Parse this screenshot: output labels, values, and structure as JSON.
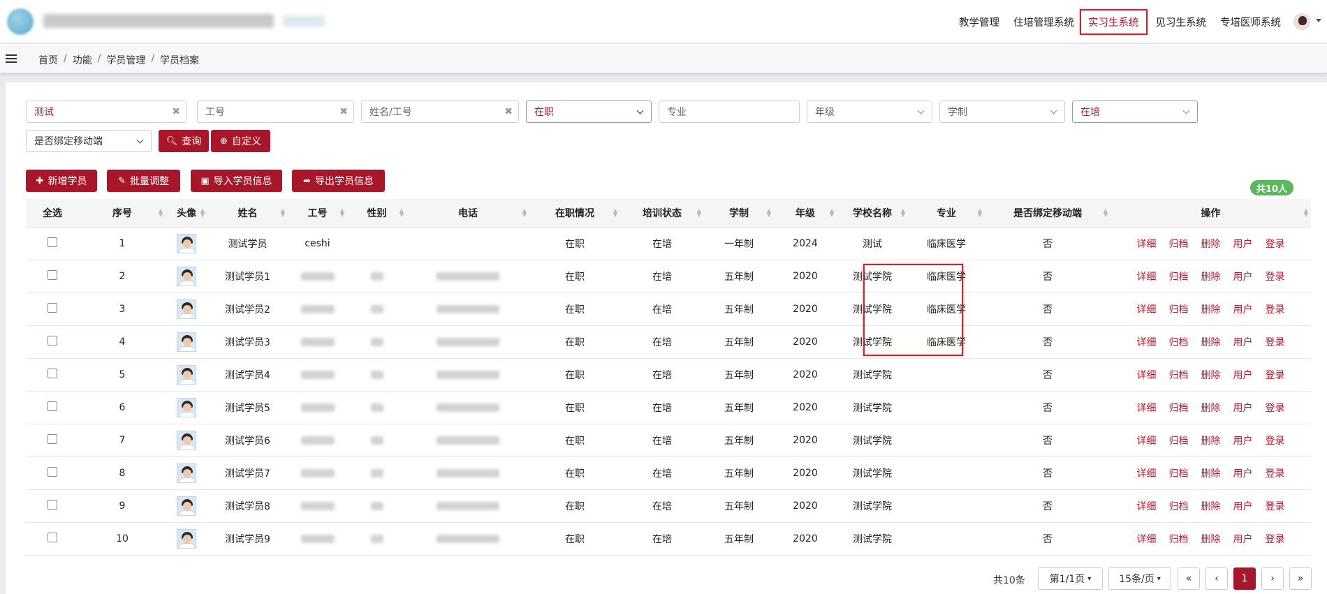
{
  "topnav": {
    "items": [
      "教学管理",
      "住培管理系统",
      "实习生系统",
      "见习生系统",
      "专培医师系统"
    ],
    "active_index": 2
  },
  "breadcrumb": [
    "首页",
    "功能",
    "学员管理",
    "学员档案"
  ],
  "filters": {
    "name_value": "测试",
    "work_id_placeholder": "工号",
    "name_or_id_placeholder": "姓名/工号",
    "job_status_value": "在职",
    "major_placeholder": "专业",
    "grade_placeholder": "年级",
    "schooling_placeholder": "学制",
    "training_status_value": "在培",
    "mobile_bind_placeholder": "是否绑定移动端",
    "query_label": "查询",
    "custom_label": "自定义"
  },
  "actions": {
    "add_label": "新增学员",
    "batch_label": "批量调整",
    "import_label": "导入学员信息",
    "export_label": "导出学员信息"
  },
  "total_badge": "共10人",
  "table": {
    "headers": [
      "全选",
      "序号",
      "头像",
      "姓名",
      "工号",
      "性别",
      "电话",
      "在职情况",
      "培训状态",
      "学制",
      "年级",
      "学校名称",
      "专业",
      "是否绑定移动端",
      "操作"
    ],
    "ops": [
      "详细",
      "归档",
      "删除",
      "用户",
      "登录"
    ],
    "rows": [
      {
        "no": "1",
        "name": "测试学员",
        "work_id": "ceshi",
        "job": "在职",
        "train": "在培",
        "schooling": "一年制",
        "grade": "2024",
        "school": "测试",
        "major": "临床医学",
        "bind": "否"
      },
      {
        "no": "2",
        "name": "测试学员1",
        "work_id": "",
        "job": "在职",
        "train": "在培",
        "schooling": "五年制",
        "grade": "2020",
        "school": "测试学院",
        "major": "临床医学",
        "bind": "否"
      },
      {
        "no": "3",
        "name": "测试学员2",
        "work_id": "",
        "job": "在职",
        "train": "在培",
        "schooling": "五年制",
        "grade": "2020",
        "school": "测试学院",
        "major": "临床医学",
        "bind": "否"
      },
      {
        "no": "4",
        "name": "测试学员3",
        "work_id": "",
        "job": "在职",
        "train": "在培",
        "schooling": "五年制",
        "grade": "2020",
        "school": "测试学院",
        "major": "临床医学",
        "bind": "否"
      },
      {
        "no": "5",
        "name": "测试学员4",
        "work_id": "",
        "job": "在职",
        "train": "在培",
        "schooling": "五年制",
        "grade": "2020",
        "school": "测试学院",
        "major": "",
        "bind": "否"
      },
      {
        "no": "6",
        "name": "测试学员5",
        "work_id": "",
        "job": "在职",
        "train": "在培",
        "schooling": "五年制",
        "grade": "2020",
        "school": "测试学院",
        "major": "",
        "bind": "否"
      },
      {
        "no": "7",
        "name": "测试学员6",
        "work_id": "",
        "job": "在职",
        "train": "在培",
        "schooling": "五年制",
        "grade": "2020",
        "school": "测试学院",
        "major": "",
        "bind": "否"
      },
      {
        "no": "8",
        "name": "测试学员7",
        "work_id": "",
        "job": "在职",
        "train": "在培",
        "schooling": "五年制",
        "grade": "2020",
        "school": "测试学院",
        "major": "",
        "bind": "否"
      },
      {
        "no": "9",
        "name": "测试学员8",
        "work_id": "",
        "job": "在职",
        "train": "在培",
        "schooling": "五年制",
        "grade": "2020",
        "school": "测试学院",
        "major": "",
        "bind": "否"
      },
      {
        "no": "10",
        "name": "测试学员9",
        "work_id": "",
        "job": "在职",
        "train": "在培",
        "schooling": "五年制",
        "grade": "2020",
        "school": "测试学院",
        "major": "",
        "bind": "否"
      }
    ]
  },
  "pagination": {
    "total": "共10条",
    "page_select": "第1/1页",
    "size_select": "15条/页",
    "first": "«",
    "prev": "‹",
    "current": "1",
    "next": "›",
    "last": "»"
  },
  "colors": {
    "brand": "#a8162a",
    "highlight_box": "#d81e2a",
    "badge": "#5cb85c"
  }
}
